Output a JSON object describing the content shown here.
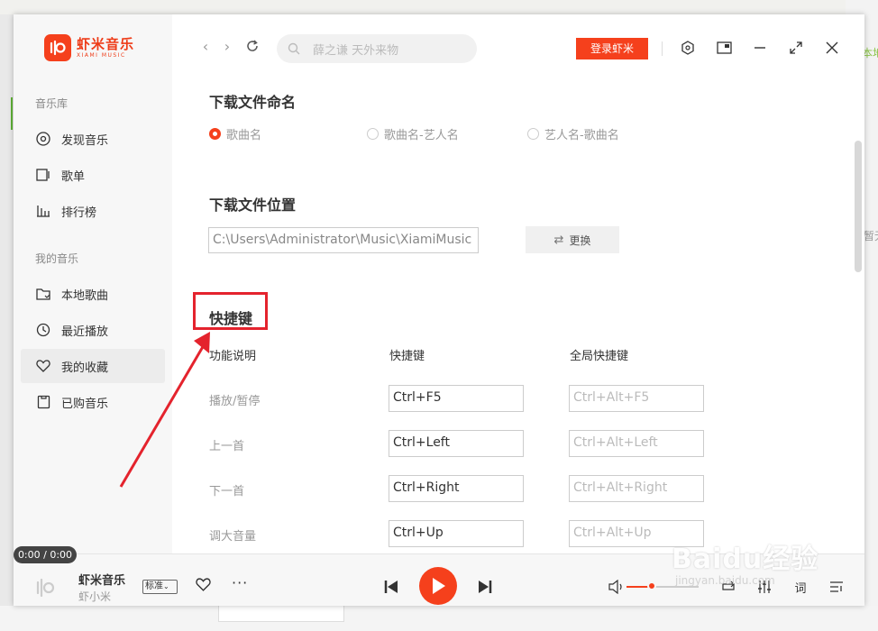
{
  "app": {
    "name": "虾米音乐",
    "name_en": "XIAMI MUSIC"
  },
  "search": {
    "placeholder": "薛之谦 天外来物"
  },
  "login_label": "登录虾米",
  "sidebar": {
    "library_title": "音乐库",
    "library_items": [
      {
        "label": "发现音乐",
        "icon": "disc-icon"
      },
      {
        "label": "歌单",
        "icon": "playlist-icon"
      },
      {
        "label": "排行榜",
        "icon": "chart-icon"
      }
    ],
    "my_title": "我的音乐",
    "my_items": [
      {
        "label": "本地歌曲",
        "icon": "folder-icon"
      },
      {
        "label": "最近播放",
        "icon": "clock-icon"
      },
      {
        "label": "我的收藏",
        "icon": "heart-icon",
        "active": true
      },
      {
        "label": "已购音乐",
        "icon": "purchased-icon"
      }
    ]
  },
  "settings": {
    "naming": {
      "title": "下载文件命名",
      "options": [
        "歌曲名",
        "歌曲名-艺人名",
        "艺人名-歌曲名"
      ],
      "selected": "歌曲名"
    },
    "location": {
      "title": "下载文件位置",
      "path": "C:\\Users\\Administrator\\Music\\XiamiMusic",
      "change_label": "更换"
    },
    "shortcuts": {
      "title": "快捷键",
      "headers": [
        "功能说明",
        "快捷键",
        "全局快捷键"
      ],
      "rows": [
        {
          "action": "播放/暂停",
          "key": "Ctrl+F5",
          "global": "Ctrl+Alt+F5"
        },
        {
          "action": "上一首",
          "key": "Ctrl+Left",
          "global": "Ctrl+Alt+Left"
        },
        {
          "action": "下一首",
          "key": "Ctrl+Right",
          "global": "Ctrl+Alt+Right"
        },
        {
          "action": "调大音量",
          "key": "Ctrl+Up",
          "global": "Ctrl+Alt+Up"
        }
      ]
    }
  },
  "player": {
    "time": "0:00 / 0:00",
    "title": "虾米音乐",
    "artist": "虾小米",
    "quality": "标准",
    "volume_fraction": 0.35,
    "lyrics_label": "词"
  },
  "background": {
    "right_text": "本地",
    "right_text2": "暂无"
  },
  "watermark": {
    "line1": "Baidu经验",
    "line2": "jingyan.baidu.com"
  },
  "colors": {
    "accent": "#f5401c",
    "highlight": "#e4232d"
  }
}
